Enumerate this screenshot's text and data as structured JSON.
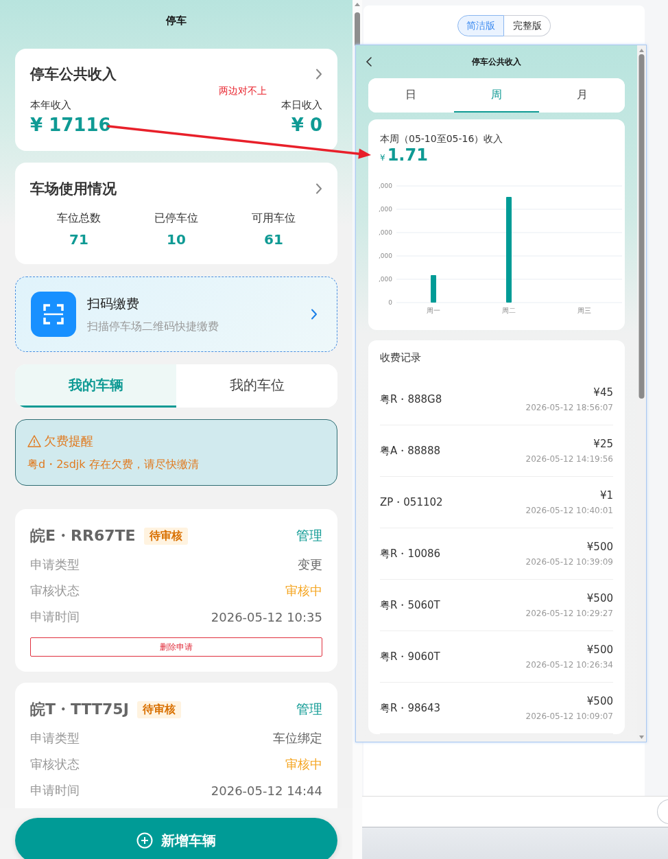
{
  "left_panel": {
    "title": "停车",
    "income_card": {
      "title": "停车公共收入",
      "year_label": "本年收入",
      "year_value": "¥ 17116",
      "day_label": "本日收入",
      "day_value": "¥ 0",
      "note": "两边对不上"
    },
    "usage_card": {
      "title": "车场使用情况",
      "stats": [
        {
          "label": "车位总数",
          "value": "71"
        },
        {
          "label": "已停车位",
          "value": "10"
        },
        {
          "label": "可用车位",
          "value": "61"
        }
      ]
    },
    "scan_card": {
      "title": "扫码缴费",
      "subtitle": "扫描停车场二维码快捷缴费"
    },
    "tabs": [
      {
        "label": "我的车辆",
        "selected": true
      },
      {
        "label": "我的车位",
        "selected": false
      }
    ],
    "alert": {
      "title": "欠费提醒",
      "message": "粤d・2sdjk 存在欠费，请尽快缴清"
    },
    "vehicles": [
      {
        "plate": "皖E・RR67TE",
        "badge": "待审核",
        "action": "管理",
        "fields": [
          {
            "label": "申请类型",
            "value": "变更",
            "kind": "plain"
          },
          {
            "label": "审核状态",
            "value": "审核中",
            "kind": "status"
          },
          {
            "label": "申请时间",
            "value": "2026-05-12 10:35",
            "kind": "plain"
          }
        ],
        "delete_button": "删除申请"
      },
      {
        "plate": "皖T・TTT75J",
        "badge": "待审核",
        "action": "管理",
        "fields": [
          {
            "label": "申请类型",
            "value": "车位绑定",
            "kind": "plain"
          },
          {
            "label": "审核状态",
            "value": "审核中",
            "kind": "status"
          },
          {
            "label": "申请时间",
            "value": "2026-05-12 14:44",
            "kind": "plain"
          }
        ]
      }
    ],
    "add_button": "新增车辆"
  },
  "right_panel": {
    "version_toggle": [
      {
        "label": "简洁版",
        "selected": true
      },
      {
        "label": "完整版",
        "selected": false
      }
    ],
    "popup": {
      "title": "停车公共收入",
      "period_tabs": [
        {
          "label": "日",
          "selected": false
        },
        {
          "label": "周",
          "selected": true
        },
        {
          "label": "月",
          "selected": false
        }
      ],
      "summary_label": "本周（05-10至05-16）收入",
      "currency": "¥",
      "amount": "1.71",
      "chart": {
        "y_tick_labels": [
          ",000",
          ",000",
          ",000",
          ",000",
          ",000",
          "0"
        ],
        "categories": [
          "周一",
          "周二",
          "周三"
        ]
      },
      "records_title": "收费记录",
      "records": [
        {
          "plate": "粤R・888G8",
          "amount": "¥45",
          "time": "2026-05-12 18:56:07"
        },
        {
          "plate": "粤A・88888",
          "amount": "¥25",
          "time": "2026-05-12 14:19:56"
        },
        {
          "plate": "ZP・051102",
          "amount": "¥1",
          "time": "2026-05-12 10:40:01"
        },
        {
          "plate": "粤R・10086",
          "amount": "¥500",
          "time": "2026-05-12 10:39:09"
        },
        {
          "plate": "粤R・5060T",
          "amount": "¥500",
          "time": "2026-05-12 10:29:27"
        },
        {
          "plate": "粤R・9060T",
          "amount": "¥500",
          "time": "2026-05-12 10:26:34"
        },
        {
          "plate": "粤R・98643",
          "amount": "¥500",
          "time": "2026-05-12 10:09:07"
        }
      ]
    }
  }
}
